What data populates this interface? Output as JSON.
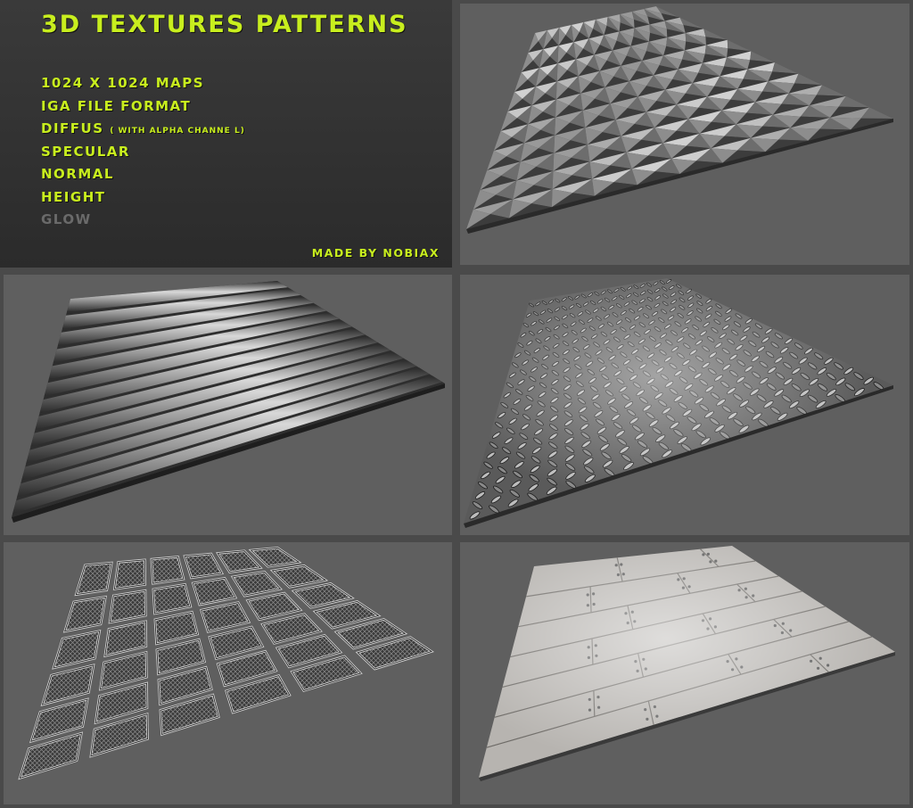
{
  "info": {
    "title": "3D TEXTURES PATTERNS",
    "specs": [
      {
        "text": "1024 X 1024 MAPS",
        "note": ""
      },
      {
        "text": "IGA FILE FORMAT",
        "note": ""
      },
      {
        "text": "DIFFUS",
        "note": "( WITH ALPHA CHANNE L)"
      },
      {
        "text": "SPECULAR",
        "note": ""
      },
      {
        "text": "NORMAL",
        "note": ""
      },
      {
        "text": "HEIGHT",
        "note": ""
      },
      {
        "text": "GLOW",
        "note": "",
        "dimmed": true
      }
    ],
    "credit": "MADE BY NOBIAX"
  },
  "colors": {
    "accent": "#c8ee1e",
    "dimmed_text": "#6a6a6a",
    "panel_background": "#5f5f5f",
    "page_background": "#4a4a4a"
  },
  "previews": [
    {
      "id": "pyramid-studs",
      "pattern": "pyramid-studs"
    },
    {
      "id": "corrugated",
      "pattern": "corrugated-ridges"
    },
    {
      "id": "diamond-plate",
      "pattern": "diamond-tread-plate"
    },
    {
      "id": "grate-tiles",
      "pattern": "mesh-grate-tiles"
    },
    {
      "id": "riveted-plates",
      "pattern": "riveted-plates"
    }
  ]
}
